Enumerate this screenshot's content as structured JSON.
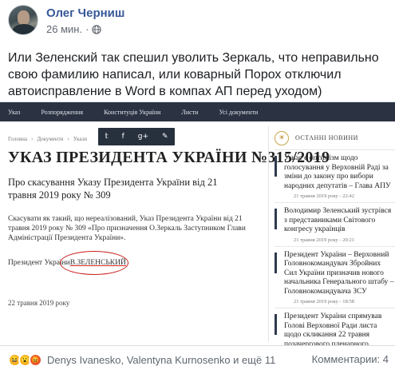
{
  "post": {
    "author": "Олег Черниш",
    "time": "26 мин.",
    "globe_icon": "globe-icon",
    "text": "Или Зеленский так спешил уволить Зеркаль, что неправильно свою фамилию написал, или коварный Порох отключил автоисправление в Word в компах АП перед уходом)"
  },
  "site": {
    "nav": [
      "Указ",
      "Розпорядження",
      "Конституція України",
      "Листи",
      "Усі документи"
    ],
    "breadcrumb": [
      "Головна",
      "›",
      "Документи",
      "›",
      "Укази"
    ],
    "share_icons": [
      "twitter-icon",
      "facebook-icon",
      "google-plus-icon",
      "pen-icon"
    ],
    "share_glyphs": [
      "𝕥",
      "f",
      "g+",
      "✎"
    ],
    "decree": {
      "title": "УКАЗ ПРЕЗИДЕНТА УКРАЇНИ №315/2019",
      "subtitle": "Про скасування Указу Президента України від 21 травня 2019 року № 309",
      "body": "Скасувати як такий, що нереалізований, Указ Президента України від 21 травня 2019 року № 309 «Про призначення О.Зеркаль Заступником Глави Адміністрації Президента України».",
      "signature_prefix": "Президент України",
      "signature_name": "В.ЗЕЛЕНСЬКИЙ",
      "date": "22 травня 2019 року"
    },
    "news": {
      "logo_glyph": "☀",
      "header": "ОСТАННІ НОВИНИ",
      "items": [
        {
          "title": "У нас є оптимізм щодо голосування у Верховній Раді за зміни до закону про вибори народних депутатів – Глава АПУ",
          "time": "21 травня 2019 року - 22:42"
        },
        {
          "title": "Володимир Зеленський зустрівся з представниками Світового конгресу українців",
          "time": "21 травня 2019 року - 20:21"
        },
        {
          "title": "Президент України – Верховний Головнокомандувач Збройних Сил України призначив нового начальника Генерального штабу – Головнокомандувача ЗСУ",
          "time": "21 травня 2019 року - 18:58"
        },
        {
          "title": "Президент України спрямував Голові Верховної Ради листа щодо скликання 22 травня позачергового пленарного",
          "time": ""
        }
      ]
    }
  },
  "footer": {
    "reactions": [
      "haha-reaction-icon",
      "wow-reaction-icon",
      "angry-reaction-icon"
    ],
    "reaction_glyphs": [
      "😆",
      "😮",
      "😡"
    ],
    "reactors": "Denys Ivanesko, Valentyna Kurnosenko и ещё 11",
    "comments": "Комментарии: 4"
  },
  "colors": {
    "author_link": "#385898",
    "site_nav_bg": "#2b3342",
    "highlight_oval": "#c8201e"
  }
}
